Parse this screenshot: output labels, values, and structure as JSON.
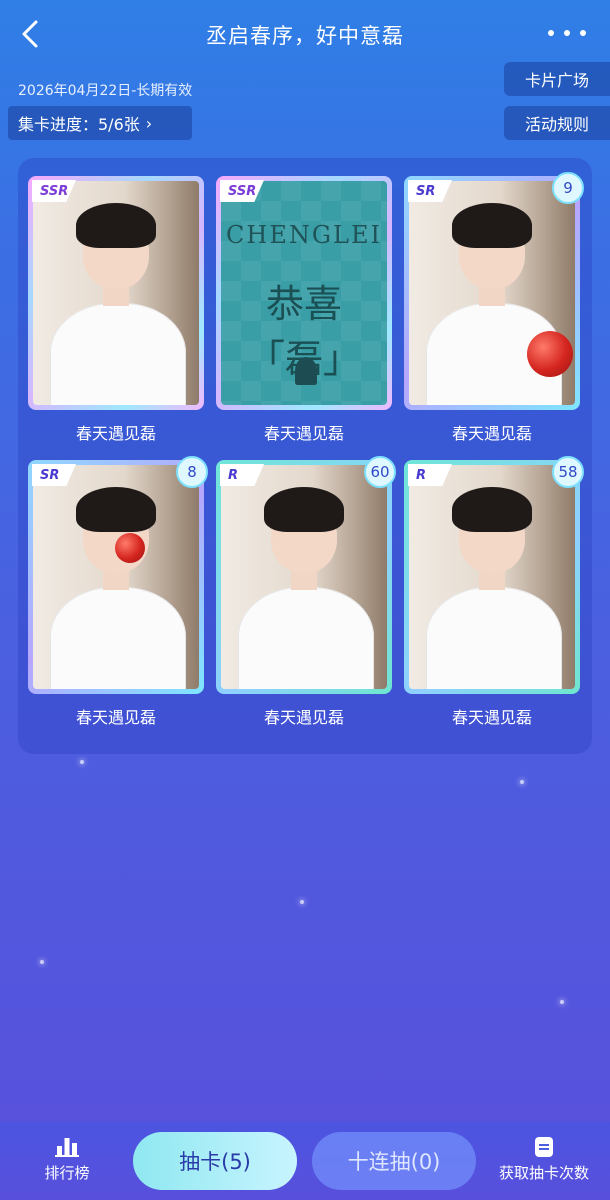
{
  "header": {
    "title": "丞启春序，好中意磊",
    "back_icon": "chevron-left-icon",
    "more_icon": "more-dots-icon"
  },
  "info": {
    "validity": "2026年04月22日-长期有效",
    "progress": "集卡进度：5/6张",
    "card_square": "卡片广场",
    "rules": "活动规则"
  },
  "cards": [
    {
      "rarity": "SSR",
      "label": "春天遇见磊",
      "count": null
    },
    {
      "rarity": "SSR",
      "label": "春天遇见磊",
      "count": null,
      "brand": "CHENGLEI",
      "caption": "恭喜「磊」"
    },
    {
      "rarity": "SR",
      "label": "春天遇见磊",
      "count": "9"
    },
    {
      "rarity": "SR",
      "label": "春天遇见磊",
      "count": "8"
    },
    {
      "rarity": "R",
      "label": "春天遇见磊",
      "count": "60"
    },
    {
      "rarity": "R",
      "label": "春天遇见磊",
      "count": "58"
    }
  ],
  "bottom": {
    "ranking": "排行榜",
    "draw": "抽卡(5)",
    "draw10": "十连抽(0)",
    "get_draws": "获取抽卡次数"
  },
  "colors": {
    "bg_top": "#2f7fe6",
    "bg_bottom": "#5a4fdc",
    "draw_btn": "#8fe8f0"
  }
}
